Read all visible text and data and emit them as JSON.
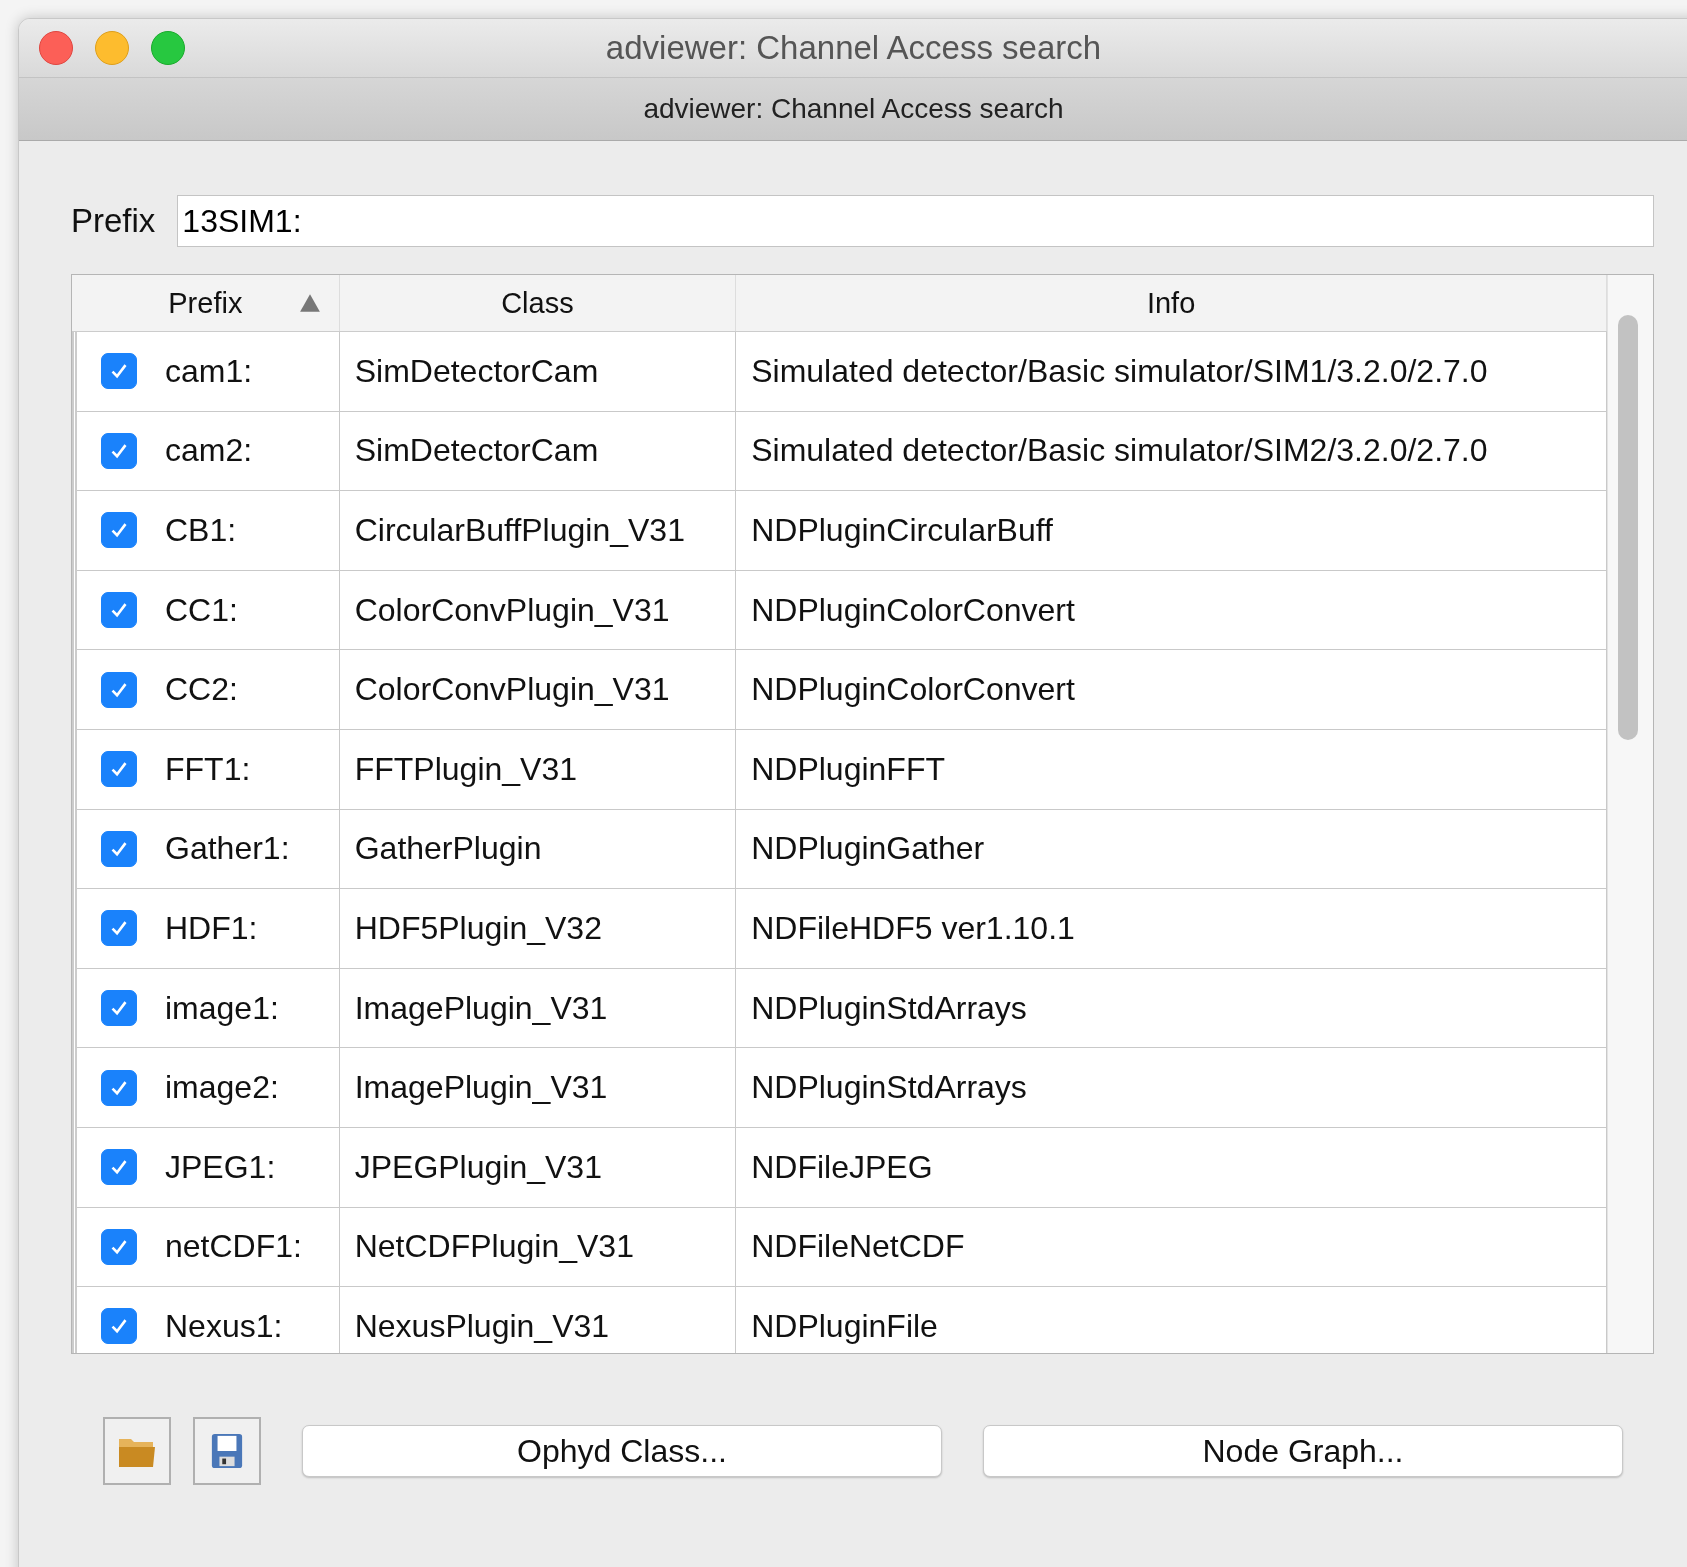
{
  "window": {
    "title": "adviewer: Channel Access search",
    "subtitle": "adviewer: Channel Access search"
  },
  "prefix_field": {
    "label": "Prefix",
    "value": "13SIM1:"
  },
  "table": {
    "columns": [
      {
        "label": "Prefix",
        "sort_ascending": true
      },
      {
        "label": "Class"
      },
      {
        "label": "Info"
      }
    ],
    "rows": [
      {
        "checked": true,
        "prefix": "cam1:",
        "class": "SimDetectorCam",
        "info": "Simulated detector/Basic simulator/SIM1/3.2.0/2.7.0"
      },
      {
        "checked": true,
        "prefix": "cam2:",
        "class": "SimDetectorCam",
        "info": "Simulated detector/Basic simulator/SIM2/3.2.0/2.7.0"
      },
      {
        "checked": true,
        "prefix": "CB1:",
        "class": "CircularBuffPlugin_V31",
        "info": "NDPluginCircularBuff"
      },
      {
        "checked": true,
        "prefix": "CC1:",
        "class": "ColorConvPlugin_V31",
        "info": "NDPluginColorConvert"
      },
      {
        "checked": true,
        "prefix": "CC2:",
        "class": "ColorConvPlugin_V31",
        "info": "NDPluginColorConvert"
      },
      {
        "checked": true,
        "prefix": "FFT1:",
        "class": "FFTPlugin_V31",
        "info": "NDPluginFFT"
      },
      {
        "checked": true,
        "prefix": "Gather1:",
        "class": "GatherPlugin",
        "info": "NDPluginGather"
      },
      {
        "checked": true,
        "prefix": "HDF1:",
        "class": "HDF5Plugin_V32",
        "info": "NDFileHDF5 ver1.10.1"
      },
      {
        "checked": true,
        "prefix": "image1:",
        "class": "ImagePlugin_V31",
        "info": "NDPluginStdArrays"
      },
      {
        "checked": true,
        "prefix": "image2:",
        "class": "ImagePlugin_V31",
        "info": "NDPluginStdArrays"
      },
      {
        "checked": true,
        "prefix": "JPEG1:",
        "class": "JPEGPlugin_V31",
        "info": "NDFileJPEG"
      },
      {
        "checked": true,
        "prefix": "netCDF1:",
        "class": "NetCDFPlugin_V31",
        "info": "NDFileNetCDF"
      },
      {
        "checked": true,
        "prefix": "Nexus1:",
        "class": "NexusPlugin_V31",
        "info": "NDPluginFile"
      }
    ]
  },
  "buttons": [
    {
      "label": "Ophyd Class..."
    },
    {
      "label": "Node Graph..."
    }
  ]
}
